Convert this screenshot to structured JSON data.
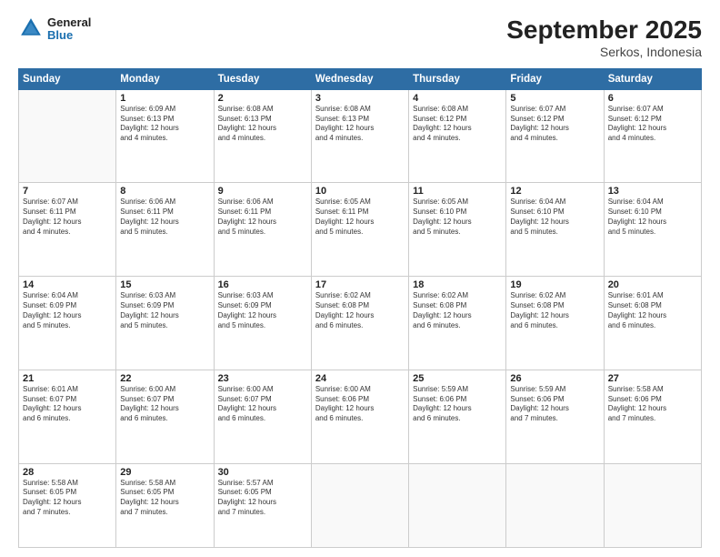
{
  "header": {
    "logo": {
      "general": "General",
      "blue": "Blue"
    },
    "title": "September 2025",
    "subtitle": "Serkos, Indonesia"
  },
  "calendar": {
    "weekdays": [
      "Sunday",
      "Monday",
      "Tuesday",
      "Wednesday",
      "Thursday",
      "Friday",
      "Saturday"
    ],
    "weeks": [
      [
        {
          "day": "",
          "info": ""
        },
        {
          "day": "1",
          "info": "Sunrise: 6:09 AM\nSunset: 6:13 PM\nDaylight: 12 hours\nand 4 minutes."
        },
        {
          "day": "2",
          "info": "Sunrise: 6:08 AM\nSunset: 6:13 PM\nDaylight: 12 hours\nand 4 minutes."
        },
        {
          "day": "3",
          "info": "Sunrise: 6:08 AM\nSunset: 6:13 PM\nDaylight: 12 hours\nand 4 minutes."
        },
        {
          "day": "4",
          "info": "Sunrise: 6:08 AM\nSunset: 6:12 PM\nDaylight: 12 hours\nand 4 minutes."
        },
        {
          "day": "5",
          "info": "Sunrise: 6:07 AM\nSunset: 6:12 PM\nDaylight: 12 hours\nand 4 minutes."
        },
        {
          "day": "6",
          "info": "Sunrise: 6:07 AM\nSunset: 6:12 PM\nDaylight: 12 hours\nand 4 minutes."
        }
      ],
      [
        {
          "day": "7",
          "info": "Sunrise: 6:07 AM\nSunset: 6:11 PM\nDaylight: 12 hours\nand 4 minutes."
        },
        {
          "day": "8",
          "info": "Sunrise: 6:06 AM\nSunset: 6:11 PM\nDaylight: 12 hours\nand 5 minutes."
        },
        {
          "day": "9",
          "info": "Sunrise: 6:06 AM\nSunset: 6:11 PM\nDaylight: 12 hours\nand 5 minutes."
        },
        {
          "day": "10",
          "info": "Sunrise: 6:05 AM\nSunset: 6:11 PM\nDaylight: 12 hours\nand 5 minutes."
        },
        {
          "day": "11",
          "info": "Sunrise: 6:05 AM\nSunset: 6:10 PM\nDaylight: 12 hours\nand 5 minutes."
        },
        {
          "day": "12",
          "info": "Sunrise: 6:04 AM\nSunset: 6:10 PM\nDaylight: 12 hours\nand 5 minutes."
        },
        {
          "day": "13",
          "info": "Sunrise: 6:04 AM\nSunset: 6:10 PM\nDaylight: 12 hours\nand 5 minutes."
        }
      ],
      [
        {
          "day": "14",
          "info": "Sunrise: 6:04 AM\nSunset: 6:09 PM\nDaylight: 12 hours\nand 5 minutes."
        },
        {
          "day": "15",
          "info": "Sunrise: 6:03 AM\nSunset: 6:09 PM\nDaylight: 12 hours\nand 5 minutes."
        },
        {
          "day": "16",
          "info": "Sunrise: 6:03 AM\nSunset: 6:09 PM\nDaylight: 12 hours\nand 5 minutes."
        },
        {
          "day": "17",
          "info": "Sunrise: 6:02 AM\nSunset: 6:08 PM\nDaylight: 12 hours\nand 6 minutes."
        },
        {
          "day": "18",
          "info": "Sunrise: 6:02 AM\nSunset: 6:08 PM\nDaylight: 12 hours\nand 6 minutes."
        },
        {
          "day": "19",
          "info": "Sunrise: 6:02 AM\nSunset: 6:08 PM\nDaylight: 12 hours\nand 6 minutes."
        },
        {
          "day": "20",
          "info": "Sunrise: 6:01 AM\nSunset: 6:08 PM\nDaylight: 12 hours\nand 6 minutes."
        }
      ],
      [
        {
          "day": "21",
          "info": "Sunrise: 6:01 AM\nSunset: 6:07 PM\nDaylight: 12 hours\nand 6 minutes."
        },
        {
          "day": "22",
          "info": "Sunrise: 6:00 AM\nSunset: 6:07 PM\nDaylight: 12 hours\nand 6 minutes."
        },
        {
          "day": "23",
          "info": "Sunrise: 6:00 AM\nSunset: 6:07 PM\nDaylight: 12 hours\nand 6 minutes."
        },
        {
          "day": "24",
          "info": "Sunrise: 6:00 AM\nSunset: 6:06 PM\nDaylight: 12 hours\nand 6 minutes."
        },
        {
          "day": "25",
          "info": "Sunrise: 5:59 AM\nSunset: 6:06 PM\nDaylight: 12 hours\nand 6 minutes."
        },
        {
          "day": "26",
          "info": "Sunrise: 5:59 AM\nSunset: 6:06 PM\nDaylight: 12 hours\nand 7 minutes."
        },
        {
          "day": "27",
          "info": "Sunrise: 5:58 AM\nSunset: 6:06 PM\nDaylight: 12 hours\nand 7 minutes."
        }
      ],
      [
        {
          "day": "28",
          "info": "Sunrise: 5:58 AM\nSunset: 6:05 PM\nDaylight: 12 hours\nand 7 minutes."
        },
        {
          "day": "29",
          "info": "Sunrise: 5:58 AM\nSunset: 6:05 PM\nDaylight: 12 hours\nand 7 minutes."
        },
        {
          "day": "30",
          "info": "Sunrise: 5:57 AM\nSunset: 6:05 PM\nDaylight: 12 hours\nand 7 minutes."
        },
        {
          "day": "",
          "info": ""
        },
        {
          "day": "",
          "info": ""
        },
        {
          "day": "",
          "info": ""
        },
        {
          "day": "",
          "info": ""
        }
      ]
    ]
  }
}
